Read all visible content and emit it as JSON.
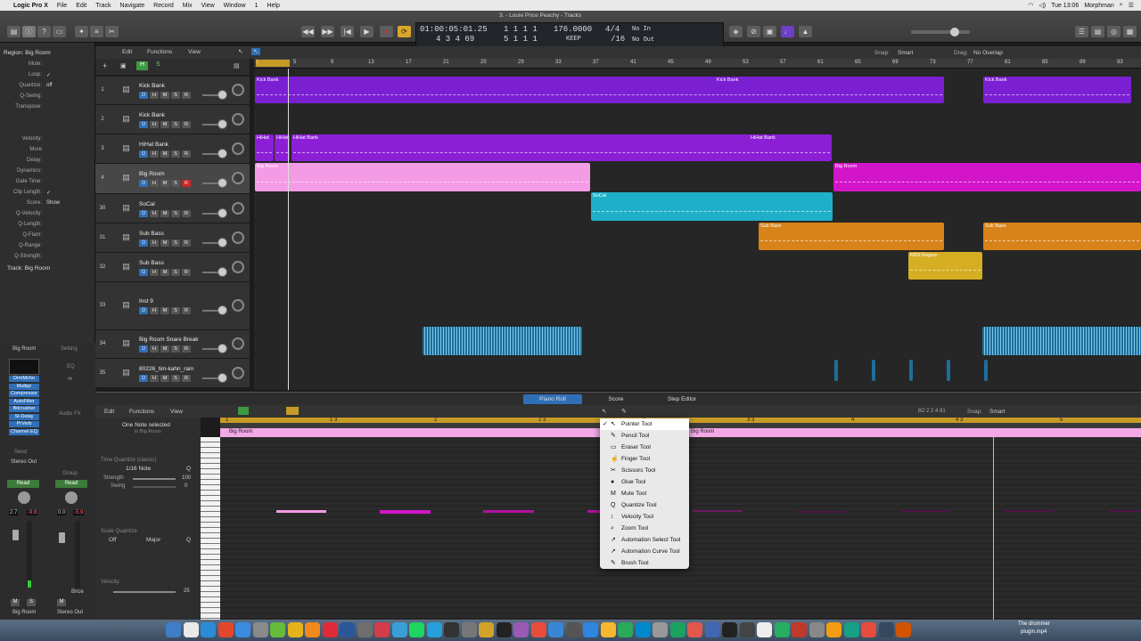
{
  "menubar": {
    "app": "Logic Pro X",
    "items": [
      "File",
      "Edit",
      "Track",
      "Navigate",
      "Record",
      "Mix",
      "View",
      "Window",
      "1",
      "Help"
    ],
    "clock": "Tue 13:06",
    "user": "Morphman"
  },
  "window_title": "3. - Louie Price Peachy - Tracks",
  "lcd": {
    "time": "01:00:05:01.25",
    "bars": "4  3  4    69",
    "pos1": "1   1   1      1",
    "pos2": "5   1   1      1",
    "tempo": "176.0000",
    "tempo_mode": "KEEP",
    "sig": "4/4",
    "div": "/16",
    "in": "No In",
    "out": "No Out"
  },
  "inspector": {
    "region_label": "Region: Big Room",
    "rows": [
      {
        "k": "Mute:",
        "v": ""
      },
      {
        "k": "Loop:",
        "v": "✓"
      },
      {
        "k": "Quantize:",
        "v": "off"
      },
      {
        "k": "Q-Swing:",
        "v": ""
      },
      {
        "k": "Transpose:",
        "v": ""
      },
      {
        "k": "Velocity:",
        "v": ""
      },
      {
        "k": "More",
        "v": ""
      },
      {
        "k": "Delay:",
        "v": ""
      },
      {
        "k": "Dynamics:",
        "v": ""
      },
      {
        "k": "Gate Time:",
        "v": ""
      },
      {
        "k": "Clip Length:",
        "v": "✓"
      },
      {
        "k": "Score:",
        "v": "Show"
      },
      {
        "k": "Q-Velocity:",
        "v": ""
      },
      {
        "k": "Q-Length:",
        "v": ""
      },
      {
        "k": "Q-Flam:",
        "v": ""
      },
      {
        "k": "Q-Range:",
        "v": ""
      },
      {
        "k": "Q-Strength:",
        "v": ""
      }
    ],
    "track_label": "Track: Big Room",
    "strip1_name": "Big Room",
    "strip2_name": "Setting",
    "plugins": [
      "DrmMchn",
      "Multipr",
      "Compressor",
      "AutoFilter",
      "Bitcrusher",
      "St-Delay",
      "PrVerb",
      "Channel EQ"
    ],
    "send_label": "Send",
    "stereo_out": "Stereo Out",
    "group": "Group",
    "read1": "Read",
    "read2": "Read",
    "vol1": "2.7",
    "vol1b": "-9.8",
    "vol2": "0.0",
    "vol2b": "-5.9",
    "bnce": "Bnce",
    "strip_footer1": "Big Room",
    "strip_footer2": "Stereo Out",
    "audio_fx": "Audio FX",
    "eq": "EQ"
  },
  "arrange_toolbar": {
    "edit": "Edit",
    "functions": "Functions",
    "view": "View",
    "snap_label": "Snap:",
    "snap_value": "Smart",
    "drag_label": "Drag:",
    "drag_value": "No Overlap"
  },
  "ruler_marks": [
    "1",
    "5",
    "9",
    "13",
    "17",
    "21",
    "25",
    "29",
    "33",
    "37",
    "41",
    "45",
    "49",
    "53",
    "57",
    "61",
    "65",
    "69",
    "73",
    "77",
    "81",
    "85",
    "89",
    "93"
  ],
  "tracks": [
    {
      "num": "1",
      "name": "Kick Bank",
      "rec": false
    },
    {
      "num": "2",
      "name": "Kick Bank",
      "rec": false
    },
    {
      "num": "3",
      "name": "HiHat Bank",
      "rec": false
    },
    {
      "num": "4",
      "name": "Big Room",
      "rec": true
    },
    {
      "num": "30",
      "name": "SoCal",
      "rec": false
    },
    {
      "num": "31",
      "name": "Sub Bass",
      "rec": false
    },
    {
      "num": "32",
      "name": "Sub Bass",
      "rec": false
    },
    {
      "num": "33",
      "name": "Inst 9",
      "rec": false
    },
    {
      "num": "34",
      "name": "Big Room Snare Break",
      "rec": false
    },
    {
      "num": "35",
      "name": "80226_tim-kahn_rain",
      "rec": false
    }
  ],
  "region_labels": {
    "kick1a": "Kick Bank",
    "kick1b": "Kick Bank",
    "kick1c": "Kick Bank",
    "hihat_a": "HiHat",
    "hihat_b": "HiHat",
    "hihat_c": "HiHat Bank",
    "hihat_d": "HiHat Bank",
    "bigroom_a": "Big Room",
    "bigroom_b": "Big Room",
    "socal": "SoCal",
    "sub_a": "Sub Bass",
    "sub_b": "Sub Bass",
    "midi": "MIDI Region"
  },
  "lower_tabs": [
    "Piano Roll",
    "Score",
    "Step Editor"
  ],
  "piano_roll": {
    "edit": "Edit",
    "functions": "Functions",
    "view": "View",
    "position": "B2  2 2 4 81",
    "snap_label": "Snap:",
    "snap_value": "Smart",
    "note_info": "One Note selected",
    "note_sub": "in Big Room",
    "tq_label": "Time Quantize (classic)",
    "tq_value": "1/16 Note",
    "strength_label": "Strength",
    "strength_value": "100",
    "swing_label": "Swing",
    "swing_value": "0",
    "sq_label": "Scale Quantize",
    "sq_off": "Off",
    "sq_major": "Major",
    "velocity_label": "Velocity",
    "velocity_value": "25",
    "ruler": [
      "1",
      "1 3",
      "2",
      "2 3",
      "3",
      "3 3",
      "4",
      "4 3",
      "5"
    ],
    "region_name": "Big Room",
    "region_name2": "Big Room",
    "q": "Q"
  },
  "tool_menu": [
    {
      "label": "Pointer Tool",
      "icon": "↖",
      "checked": true
    },
    {
      "label": "Pencil Tool",
      "icon": "✎",
      "checked": false
    },
    {
      "label": "Eraser Tool",
      "icon": "▭",
      "checked": false
    },
    {
      "label": "Finger Tool",
      "icon": "☝",
      "checked": false
    },
    {
      "label": "Scissors Tool",
      "icon": "✂",
      "checked": false
    },
    {
      "label": "Glue Tool",
      "icon": "●",
      "checked": false
    },
    {
      "label": "Mute Tool",
      "icon": "M",
      "checked": false
    },
    {
      "label": "Quantize Tool",
      "icon": "Q",
      "checked": false
    },
    {
      "label": "Velocity Tool",
      "icon": "↕",
      "checked": false
    },
    {
      "label": "Zoom Tool",
      "icon": "⌕",
      "checked": false
    },
    {
      "label": "Automation Select Tool",
      "icon": "↗",
      "checked": false
    },
    {
      "label": "Automation Curve Tool",
      "icon": "↗",
      "checked": false
    },
    {
      "label": "Brush Tool",
      "icon": "✎",
      "checked": false
    }
  ],
  "dock_status": {
    "line1": "The drummer",
    "line2": "plugin.mp4"
  },
  "colors": {
    "kick": "#7b1fd3",
    "hihat": "#8c1fd6",
    "bigroom_light": "#f49be6",
    "bigroom": "#d315c9",
    "socal": "#1fb0c9",
    "subbass": "#d88319",
    "midi": "#d6ae23",
    "audio": "#1d6f9c"
  }
}
